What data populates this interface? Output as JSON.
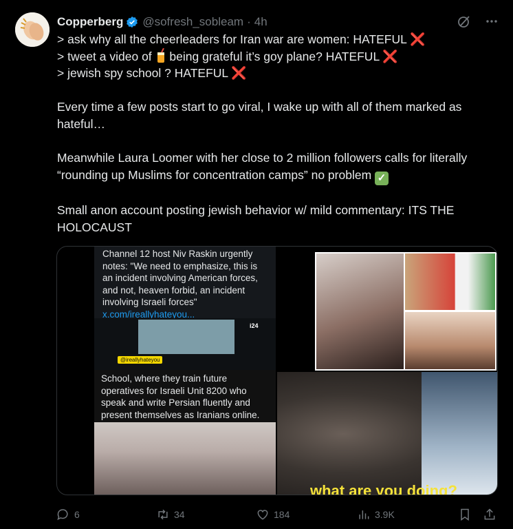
{
  "tweet": {
    "display_name": "Copperberg",
    "handle": "@sofresh_sobleam",
    "separator": "·",
    "time": "4h",
    "lines": [
      {
        "text": "> ask why all the cheerleaders for Iran war are women: HATEFUL",
        "mark": "❌"
      },
      {
        "text_before": "> tweet a video of ",
        "text_after": " being grateful it’s  goy plane? HATEFUL",
        "mark": "❌"
      },
      {
        "text": "> jewish spy school ? HATEFUL",
        "mark": "❌"
      }
    ],
    "para2": "Every time a few posts start to go viral, I wake up with all of them marked as hateful…",
    "para3": "Meanwhile Laura Loomer with her close to 2 million followers calls for literally “rounding up Muslims for concentration camps”  no problem",
    "para3_mark": "✓",
    "para4": "Small anon account posting jewish behavior w/ mild commentary: ITS THE HOLOCAUST"
  },
  "media": {
    "top_text": "Channel 12 host Niv Raskin urgently notes: \"We need to emphasize, this is an incident involving American forces, and not, heaven forbid, an incident involving Israeli forces\"",
    "top_link": "x.com/ireallyhateyou...",
    "video_tag": "@ireallyhateyou",
    "video_logo": "i24",
    "caption": "School, where they train future operatives for Israeli Unit 8200 who speak and write Persian fluently and present themselves as Iranians online.",
    "photo_caption": "what are you doing?"
  },
  "actions": {
    "replies": "6",
    "reposts": "34",
    "likes": "184",
    "views": "3.9K"
  },
  "colors": {
    "background": "#000000",
    "text": "#e7e9ea",
    "muted": "#71767b",
    "link": "#1d9bf0",
    "verified": "#1d9bf0",
    "x_mark": "#f4212e",
    "check": "#78b159"
  }
}
